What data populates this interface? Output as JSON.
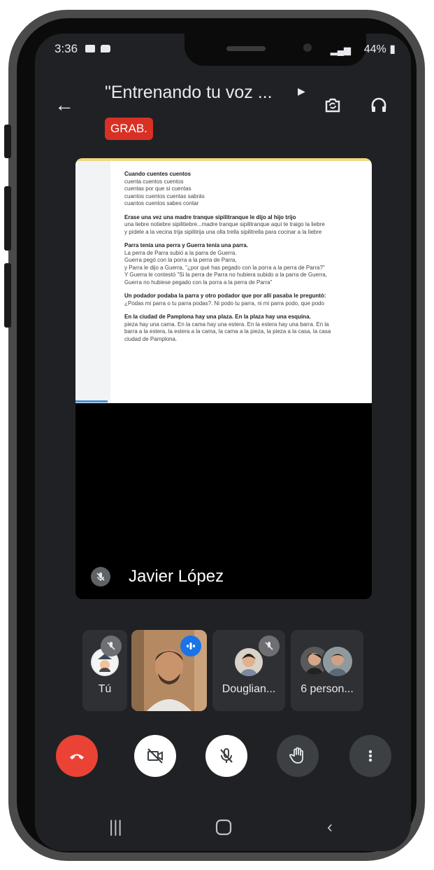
{
  "status_bar": {
    "time": "3:36",
    "battery": "44%"
  },
  "header": {
    "title": "\"Entrenando tu voz ...",
    "rec_badge": "GRAB."
  },
  "stage": {
    "speaker_name": "Javier López",
    "document": [
      {
        "bold": "Cuando cuentes cuentos",
        "lines": [
          "cuenta cuentos cuentos",
          "cuentas por que si cuentas",
          "cuantos cuentos cuentas sabrás",
          "cuantos cuentos sabes contar"
        ]
      },
      {
        "bold": "Erase una vez una madre tranque sipilitranque le dijo al hijo trijo",
        "lines": [
          "una liebre notiebre sipilitiebre...madre tranque sipilitranque aquí te traigo la liebre",
          "y pídele a la vecina trija sipilitrija una olla trella sipilitrella para cocinar a la liebre"
        ]
      },
      {
        "bold": "Parra tenía una perra y Guerra tenía una parra.",
        "lines": [
          "La perra de Parra subió a la parra de Guerra.",
          "Guerra pegó con la porra a la perra de Parra,",
          "y Parra le dijo a Guerra, \"¿por qué has pegado con la porra a la perra de Parra?\"",
          "Y Guerra le contestó \"Si la perra de Parra no hubiera subido a la parra de Guerra,",
          "Guerra no hubiese pegado con la porra a la perra de Parra\""
        ]
      },
      {
        "bold": "Un podador podaba la parra y otro podador que por allí pasaba le preguntó:",
        "lines": [
          "¿Podas mi parra o tu parra podas?. Ni podo tu parra, ni mi parra podo, que podo"
        ]
      },
      {
        "bold": "En la ciudad de Pamplona hay una plaza. En la plaza hay una esquina.",
        "lines": [
          "pieza hay una cama. En la cama hay una estera. En la estera hay una barra. En la",
          "barra a la estera, la estera a la cama, la cama a la pieza, la pieza a la casa, la casa",
          "ciudad de Pamplona."
        ]
      }
    ]
  },
  "participants": [
    {
      "label": "Tú",
      "muted": true
    },
    {
      "label": "",
      "speaking": true
    },
    {
      "label": "Douglian...",
      "muted": true
    },
    {
      "label": "6 person..."
    }
  ],
  "icons": {
    "back": "arrow-left-icon",
    "title_more": "caret-right-icon",
    "switch_camera": "switch-camera-icon",
    "audio_output": "headphones-icon",
    "mic_off": "mic-off-icon",
    "end_call": "phone-hangup-icon",
    "camera_off": "video-off-icon",
    "raise_hand": "hand-icon",
    "more": "more-vert-icon"
  },
  "colors": {
    "rec": "#d93025",
    "end_call": "#ea4335",
    "speaking": "#1a73e8",
    "background": "#202124"
  }
}
